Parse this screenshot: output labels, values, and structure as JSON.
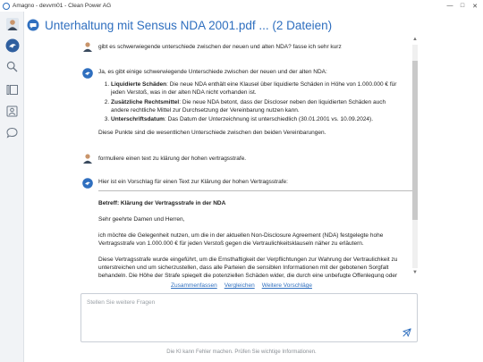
{
  "window": {
    "title": "Amagno - devvm01 - Clean Power AG"
  },
  "header": {
    "title": "Unterhaltung mit Sensus NDA 2001.pdf ... (2 Dateien)"
  },
  "messages": {
    "user1": "gibt es schwerwiegende unterschiede zwischen der neuen und alten NDA? fasse ich sehr kurz",
    "ai1": {
      "intro": "Ja, es gibt einige schwerwiegende Unterschiede zwischen der neuen und der alten NDA:",
      "points": [
        {
          "title": "Liquidierte Schäden",
          "text": ": Die neue NDA enthält eine Klausel über liquidierte Schäden in Höhe von 1.000.000 € für jeden Verstoß, was in der alten NDA nicht vorhanden ist."
        },
        {
          "title": "Zusätzliche Rechtsmittel",
          "text": ": Die neue NDA betont, dass der Discloser neben den liquidierten Schäden auch andere rechtliche Mittel zur Durchsetzung der Vereinbarung nutzen kann."
        },
        {
          "title": "Unterschriftsdatum",
          "text": ": Das Datum der Unterzeichnung ist unterschiedlich (30.01.2001 vs. 10.09.2024)."
        }
      ],
      "outro": "Diese Punkte sind die wesentlichen Unterschiede zwischen den beiden Vereinbarungen."
    },
    "user2": "formuliere einen text zu klärung der hohen vertragsstrafe.",
    "ai2": {
      "intro": "Hier ist ein Vorschlag für einen Text zur Klärung der hohen Vertragsstrafe:",
      "subject": "Betreff: Klärung der Vertragsstrafe in der NDA",
      "greeting": "Sehr geehrte Damen und Herren,",
      "para1": "ich möchte die Gelegenheit nutzen, um die in der aktuellen Non-Disclosure Agreement (NDA) festgelegte hohe Vertragsstrafe von 1.000.000 € für jeden Verstoß gegen die Vertraulichkeitsklauseln näher zu erläutern.",
      "para2": "Diese Vertragsstrafe wurde eingeführt, um die Ernsthaftigkeit der Verpflichtungen zur Wahrung der Vertraulichkeit zu unterstreichen und um sicherzustellen, dass alle Parteien die sensiblen Informationen mit der gebotenen Sorgfalt behandeln. Die Höhe der Strafe spiegelt die potenziellen Schäden wider, die durch eine unbefugte Offenlegung oder Nutzung vertraulicher"
    }
  },
  "suggestions": [
    "Zusammenfassen",
    "Vergleichen",
    "Weitere Vorschläge"
  ],
  "input": {
    "placeholder": "Stellen Sie weitere Fragen"
  },
  "disclaimer": "Die KI kann Fehler machen. Prüfen Sie wichtige Informationen.",
  "colors": {
    "accent": "#2f6fbf",
    "sidebar": "#f1f3f6",
    "border": "#c9ced6"
  }
}
